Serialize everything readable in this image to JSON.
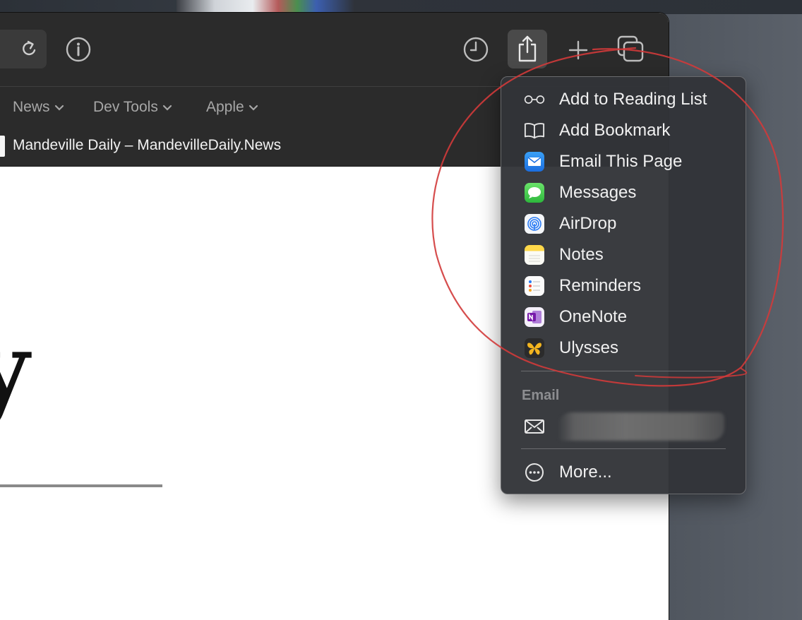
{
  "favorites_bar": {
    "items": [
      {
        "label": "News"
      },
      {
        "label": "Dev Tools"
      },
      {
        "label": "Apple"
      }
    ]
  },
  "tab": {
    "title": "Mandeville Daily – MandevilleDaily.News"
  },
  "page": {
    "visible_glyph": "y"
  },
  "share_menu": {
    "items": [
      {
        "label": "Add to Reading List",
        "icon": "glasses-icon"
      },
      {
        "label": "Add Bookmark",
        "icon": "book-icon"
      },
      {
        "label": "Email This Page",
        "icon": "mail-app-icon"
      },
      {
        "label": "Messages",
        "icon": "messages-app-icon"
      },
      {
        "label": "AirDrop",
        "icon": "airdrop-icon"
      },
      {
        "label": "Notes",
        "icon": "notes-app-icon"
      },
      {
        "label": "Reminders",
        "icon": "reminders-app-icon"
      },
      {
        "label": "OneNote",
        "icon": "onenote-app-icon"
      },
      {
        "label": "Ulysses",
        "icon": "ulysses-app-icon"
      }
    ],
    "email_section_header": "Email",
    "more_label": "More..."
  },
  "colors": {
    "toolbar_bg": "#2b2b2b",
    "menu_bg": "#323438",
    "annotation_red": "#d23a3a"
  }
}
